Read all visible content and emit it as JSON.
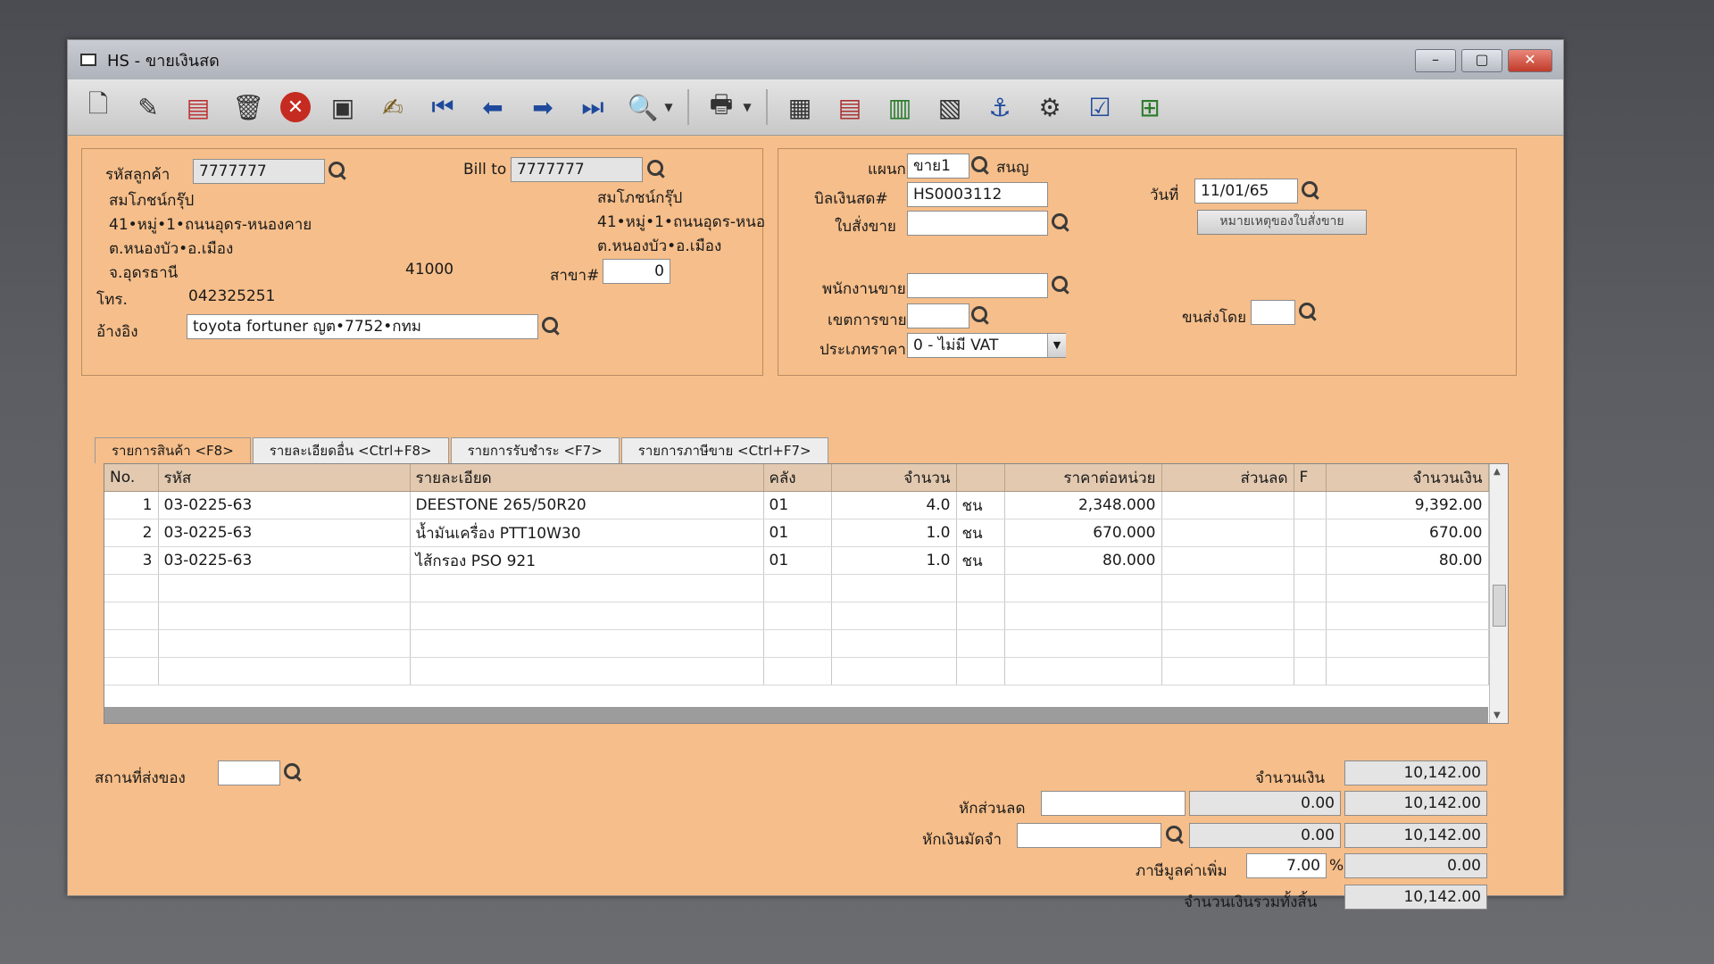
{
  "window": {
    "title": "HS - ขายเงินสด",
    "controls": [
      "–",
      "▢",
      "✕"
    ]
  },
  "toolbar": {
    "buttons": [
      "new-doc-icon",
      "edit-icon",
      "cancel-doc-icon",
      "delete-icon",
      "close-red-icon",
      "save-icon",
      "approve-icon",
      "first-record-icon",
      "prev-record-icon",
      "next-record-icon",
      "last-record-icon",
      "search-doc-icon",
      "print-icon",
      "report-icon",
      "form-icon",
      "barcode-icon",
      "calendar-icon",
      "ok-stamp-icon",
      "link-icon",
      "ok-icon",
      "export-icon"
    ]
  },
  "customer": {
    "code_label": "รหัสลูกค้า",
    "code": "7777777",
    "name": "สมโภชน์กรุ๊ป",
    "addr1": "41•หมู่•1•ถนนอุดร-หนองคาย",
    "addr2": "ต.หนองบัว•อ.เมือง",
    "addr3": "จ.อุดรธานี",
    "zip": "41000",
    "phone_label": "โทร.",
    "phone": "042325251",
    "ref_label": "อ้างอิง",
    "ref": "toyota fortuner ญต•7752•กทม"
  },
  "billto": {
    "label": "Bill to",
    "code": "7777777",
    "name": "สมโภชน์กรุ๊ป",
    "addr1": "41•หมู่•1•ถนนอุดร-หนอ",
    "addr2": "ต.หนองบัว•อ.เมือง",
    "branch_label": "สาขา#",
    "branch": "0"
  },
  "doc": {
    "dept_label": "แผนก",
    "dept": "ขาย1",
    "dept_name": "สนญ",
    "bill_label": "บิลเงินสด#",
    "bill_no": "HS0003112",
    "order_label": "ใบสั่งขาย",
    "order_no": "",
    "date_label": "วันที่",
    "date": "11/01/65",
    "note_button": "หมายเหตุของใบสั่งขาย",
    "sales_label": "พนักงานขาย",
    "sales": "",
    "area_label": "เขตการขาย",
    "area": "",
    "ship_label": "ขนส่งโดย",
    "ship": "",
    "price_type_label": "ประเภทราคา",
    "price_type": "0 - ไม่มี VAT"
  },
  "tabs": [
    "รายการสินค้า <F8>",
    "รายละเอียดอื่น <Ctrl+F8>",
    "รายการรับชำระ <F7>",
    "รายการภาษีขาย <Ctrl+F7>"
  ],
  "table": {
    "headers": [
      "No.",
      "รหัส",
      "รายละเอียด",
      "คลัง",
      "จำนวน",
      "",
      "ราคาต่อหน่วย",
      "ส่วนลด",
      "F",
      "จำนวนเงิน"
    ],
    "rows": [
      [
        "1",
        "03-0225-63",
        "DEESTONE 265/50R20",
        "01",
        "4.0",
        "ชน",
        "2,348.000",
        "",
        "",
        "9,392.00"
      ],
      [
        "2",
        "03-0225-63",
        "น้ำมันเครื่อง PTT10W30",
        "01",
        "1.0",
        "ชน",
        "670.000",
        "",
        "",
        "670.00"
      ],
      [
        "3",
        "03-0225-63",
        "ไส้กรอง PSO 921",
        "01",
        "1.0",
        "ชน",
        "80.000",
        "",
        "",
        "80.00"
      ]
    ]
  },
  "footer": {
    "delivery_label": "สถานที่ส่งของ",
    "delivery": "",
    "amount_label": "จำนวนเงิน",
    "amount": "10,142.00",
    "discount_label": "หักส่วนลด",
    "discount_text": "",
    "discount_value": "0.00",
    "after_discount": "10,142.00",
    "deposit_label": "หักเงินมัดจำ",
    "deposit_text": "",
    "deposit_value": "0.00",
    "after_deposit": "10,142.00",
    "vat_label": "ภาษีมูลค่าเพิ่ม",
    "vat_rate": "7.00",
    "vat_pct": "%",
    "vat_amount": "0.00",
    "total_label": "จำนวนเงินรวมทั้งสิ้น",
    "total": "10,142.00"
  }
}
